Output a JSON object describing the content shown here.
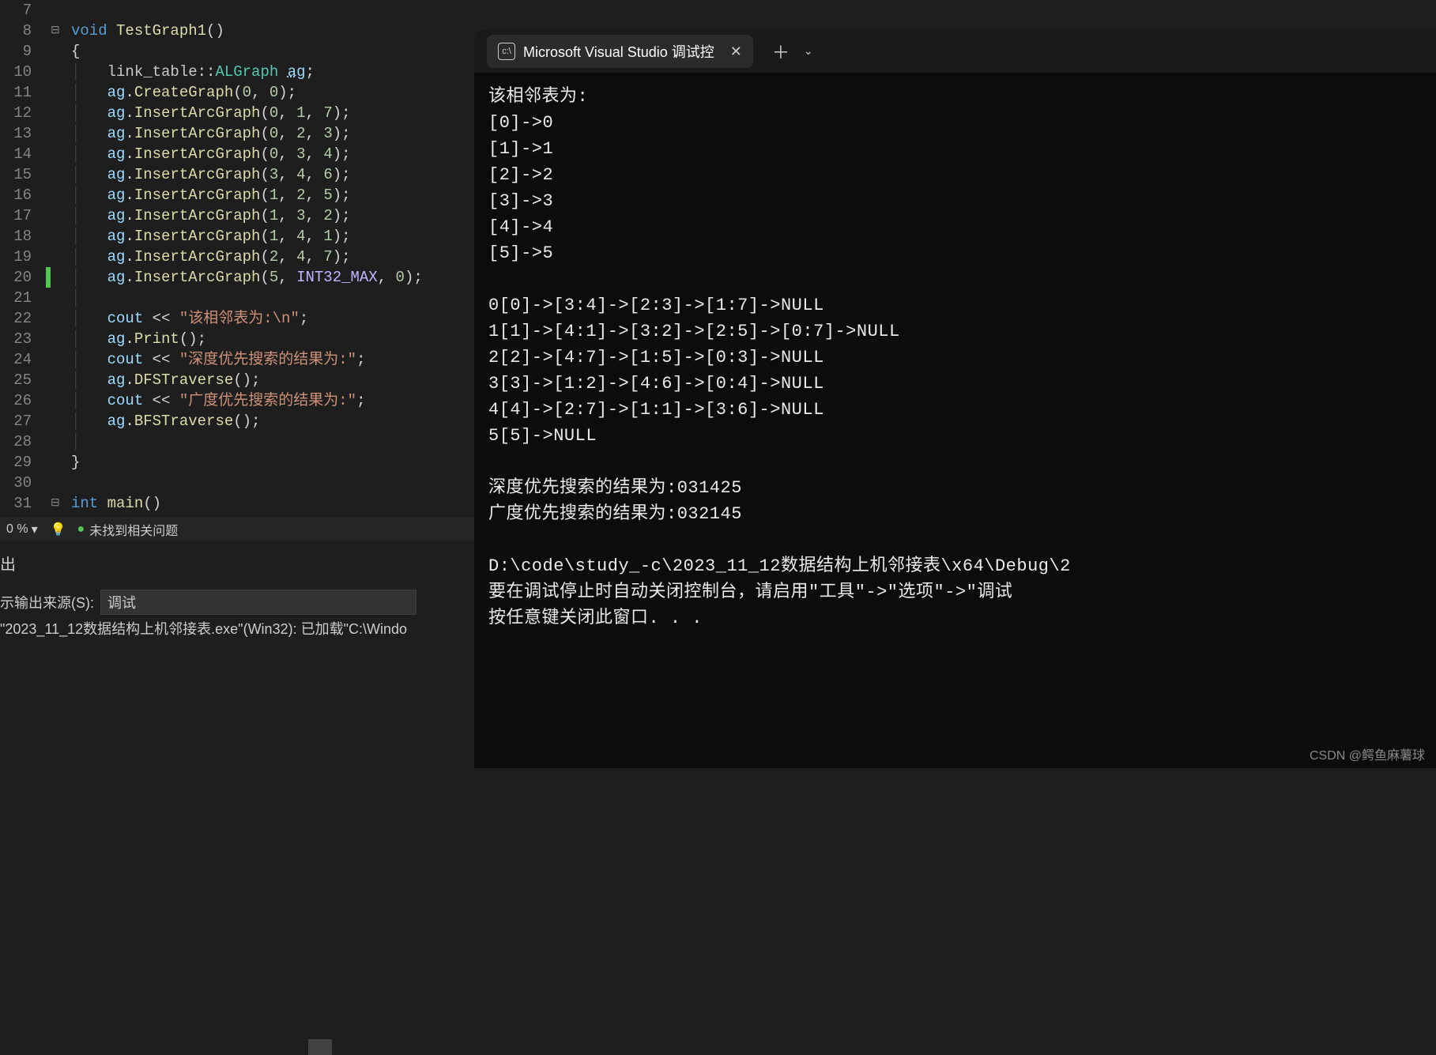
{
  "editor": {
    "lines": [
      {
        "num": "7",
        "fold": "",
        "html": ""
      },
      {
        "num": "8",
        "fold": "⊟",
        "html": "<span class='kw-void'>void</span> <span class='fn-name'>TestGraph1</span><span class='punct'>()</span>"
      },
      {
        "num": "9",
        "fold": "",
        "html": "<span class='punct'>{</span>"
      },
      {
        "num": "10",
        "fold": "",
        "html": "<span class='guide-line'>│   </span><span class='namespace'>link_table</span><span class='punct'>::</span><span class='type-name'>ALGraph</span> <span class='var-name' style='text-decoration:underline dotted'>ag</span><span class='punct'>;</span>"
      },
      {
        "num": "11",
        "fold": "",
        "html": "<span class='guide-line'>│   </span><span class='var-name'>ag</span><span class='punct'>.</span><span class='method'>CreateGraph</span><span class='punct'>(</span><span class='num'>0</span><span class='punct'>, </span><span class='num'>0</span><span class='punct'>);</span>"
      },
      {
        "num": "12",
        "fold": "",
        "html": "<span class='guide-line'>│   </span><span class='var-name'>ag</span><span class='punct'>.</span><span class='method'>InsertArcGraph</span><span class='punct'>(</span><span class='num'>0</span><span class='punct'>, </span><span class='num'>1</span><span class='punct'>, </span><span class='num'>7</span><span class='punct'>);</span>"
      },
      {
        "num": "13",
        "fold": "",
        "html": "<span class='guide-line'>│   </span><span class='var-name'>ag</span><span class='punct'>.</span><span class='method'>InsertArcGraph</span><span class='punct'>(</span><span class='num'>0</span><span class='punct'>, </span><span class='num'>2</span><span class='punct'>, </span><span class='num'>3</span><span class='punct'>);</span>"
      },
      {
        "num": "14",
        "fold": "",
        "html": "<span class='guide-line'>│   </span><span class='var-name'>ag</span><span class='punct'>.</span><span class='method'>InsertArcGraph</span><span class='punct'>(</span><span class='num'>0</span><span class='punct'>, </span><span class='num'>3</span><span class='punct'>, </span><span class='num'>4</span><span class='punct'>);</span>"
      },
      {
        "num": "15",
        "fold": "",
        "html": "<span class='guide-line'>│   </span><span class='var-name'>ag</span><span class='punct'>.</span><span class='method'>InsertArcGraph</span><span class='punct'>(</span><span class='num'>3</span><span class='punct'>, </span><span class='num'>4</span><span class='punct'>, </span><span class='num'>6</span><span class='punct'>);</span>"
      },
      {
        "num": "16",
        "fold": "",
        "html": "<span class='guide-line'>│   </span><span class='var-name'>ag</span><span class='punct'>.</span><span class='method'>InsertArcGraph</span><span class='punct'>(</span><span class='num'>1</span><span class='punct'>, </span><span class='num'>2</span><span class='punct'>, </span><span class='num'>5</span><span class='punct'>);</span>"
      },
      {
        "num": "17",
        "fold": "",
        "html": "<span class='guide-line'>│   </span><span class='var-name'>ag</span><span class='punct'>.</span><span class='method'>InsertArcGraph</span><span class='punct'>(</span><span class='num'>1</span><span class='punct'>, </span><span class='num'>3</span><span class='punct'>, </span><span class='num'>2</span><span class='punct'>);</span>"
      },
      {
        "num": "18",
        "fold": "",
        "html": "<span class='guide-line'>│   </span><span class='var-name'>ag</span><span class='punct'>.</span><span class='method'>InsertArcGraph</span><span class='punct'>(</span><span class='num'>1</span><span class='punct'>, </span><span class='num'>4</span><span class='punct'>, </span><span class='num'>1</span><span class='punct'>);</span>"
      },
      {
        "num": "19",
        "fold": "",
        "html": "<span class='guide-line'>│   </span><span class='var-name'>ag</span><span class='punct'>.</span><span class='method'>InsertArcGraph</span><span class='punct'>(</span><span class='num'>2</span><span class='punct'>, </span><span class='num'>4</span><span class='punct'>, </span><span class='num'>7</span><span class='punct'>);</span>"
      },
      {
        "num": "20",
        "fold": "",
        "green": true,
        "html": "<span class='guide-line'>│   </span><span class='var-name'>ag</span><span class='punct'>.</span><span class='method'>InsertArcGraph</span><span class='punct'>(</span><span class='num'>5</span><span class='punct'>, </span><span class='macro'>INT32_MAX</span><span class='punct'>, </span><span class='num'>0</span><span class='punct'>);</span>"
      },
      {
        "num": "21",
        "fold": "",
        "html": "<span class='guide-line'>│</span>"
      },
      {
        "num": "22",
        "fold": "",
        "html": "<span class='guide-line'>│   </span><span class='var-name'>cout</span> <span class='op'>&lt;&lt;</span> <span class='str'>\"该相邻表为:\\n\"</span><span class='punct'>;</span>"
      },
      {
        "num": "23",
        "fold": "",
        "html": "<span class='guide-line'>│   </span><span class='var-name'>ag</span><span class='punct'>.</span><span class='method'>Print</span><span class='punct'>();</span>"
      },
      {
        "num": "24",
        "fold": "",
        "html": "<span class='guide-line'>│   </span><span class='var-name'>cout</span> <span class='op'>&lt;&lt;</span> <span class='str'>\"深度优先搜索的结果为:\"</span><span class='punct'>;</span>"
      },
      {
        "num": "25",
        "fold": "",
        "html": "<span class='guide-line'>│   </span><span class='var-name'>ag</span><span class='punct'>.</span><span class='method'>DFSTraverse</span><span class='punct'>();</span>"
      },
      {
        "num": "26",
        "fold": "",
        "html": "<span class='guide-line'>│   </span><span class='var-name'>cout</span> <span class='op'>&lt;&lt;</span> <span class='str'>\"广度优先搜索的结果为:\"</span><span class='punct'>;</span>"
      },
      {
        "num": "27",
        "fold": "",
        "html": "<span class='guide-line'>│   </span><span class='var-name'>ag</span><span class='punct'>.</span><span class='method'>BFSTraverse</span><span class='punct'>();</span>"
      },
      {
        "num": "28",
        "fold": "",
        "html": "<span class='guide-line'>│</span>"
      },
      {
        "num": "29",
        "fold": "",
        "html": "<span class='punct'>}</span>"
      },
      {
        "num": "30",
        "fold": "",
        "html": ""
      },
      {
        "num": "31",
        "fold": "⊟",
        "html": "<span class='kw-int'>int</span> <span class='fn-name'>main</span><span class='punct'>()</span>"
      }
    ]
  },
  "status": {
    "percent": "0 %",
    "issues": "未找到相关问题"
  },
  "output": {
    "header": "出",
    "source_label": "示输出来源(S):",
    "source_value": "调试",
    "log": "\"2023_11_12数据结构上机邻接表.exe\"(Win32): 已加载\"C:\\Windo"
  },
  "console": {
    "tab_title": "Microsoft Visual Studio 调试控",
    "content": "该相邻表为:\n[0]->0\n[1]->1\n[2]->2\n[3]->3\n[4]->4\n[5]->5\n\n0[0]->[3:4]->[2:3]->[1:7]->NULL\n1[1]->[4:1]->[3:2]->[2:5]->[0:7]->NULL\n2[2]->[4:7]->[1:5]->[0:3]->NULL\n3[3]->[1:2]->[4:6]->[0:4]->NULL\n4[4]->[2:7]->[1:1]->[3:6]->NULL\n5[5]->NULL\n\n深度优先搜索的结果为:031425\n广度优先搜索的结果为:032145\n\nD:\\code\\study_-c\\2023_11_12数据结构上机邻接表\\x64\\Debug\\2\n要在调试停止时自动关闭控制台，请启用\"工具\"->\"选项\"->\"调试\n按任意键关闭此窗口. . ."
  },
  "watermark": "CSDN @鳄鱼麻薯球"
}
